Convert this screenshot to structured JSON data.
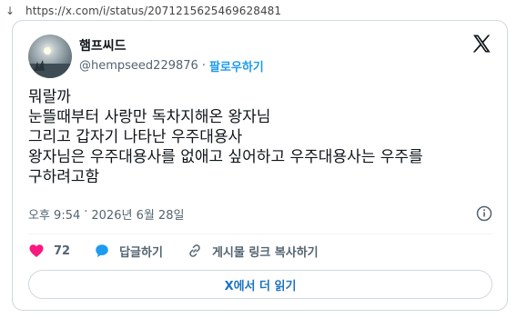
{
  "browser": {
    "url": "https://x.com/i/status/2071215625469628481",
    "back_icon": "download-arrow-icon"
  },
  "tweet": {
    "author_name": "햄프씨드",
    "handle": "@hempseed229876",
    "separator": "·",
    "follow_label": "팔로우하기",
    "logo_icon": "x-logo-icon",
    "lines": [
      "뭐랄까",
      "눈뜰때부터 사랑만 독차지해온 왕자님",
      "그리고 갑자기 나타난 우주대용사",
      "왕자님은 우주대용사를 없애고 싶어하고 우주대용사는 우주를",
      "구하려고함"
    ],
    "time": "오후 9:54",
    "date_sep": "·",
    "date": "2026년 6월 28일",
    "info_icon": "info-icon",
    "like_count": "72",
    "reply_label": "답글하기",
    "copy_link_label": "게시물 링크 복사하기",
    "read_more_label": "X에서 더 읽기",
    "colors": {
      "accent": "#1d9bf0",
      "like": "#f91880",
      "text": "#0f1419",
      "secondary": "#536471",
      "border": "#cfd9de"
    }
  }
}
